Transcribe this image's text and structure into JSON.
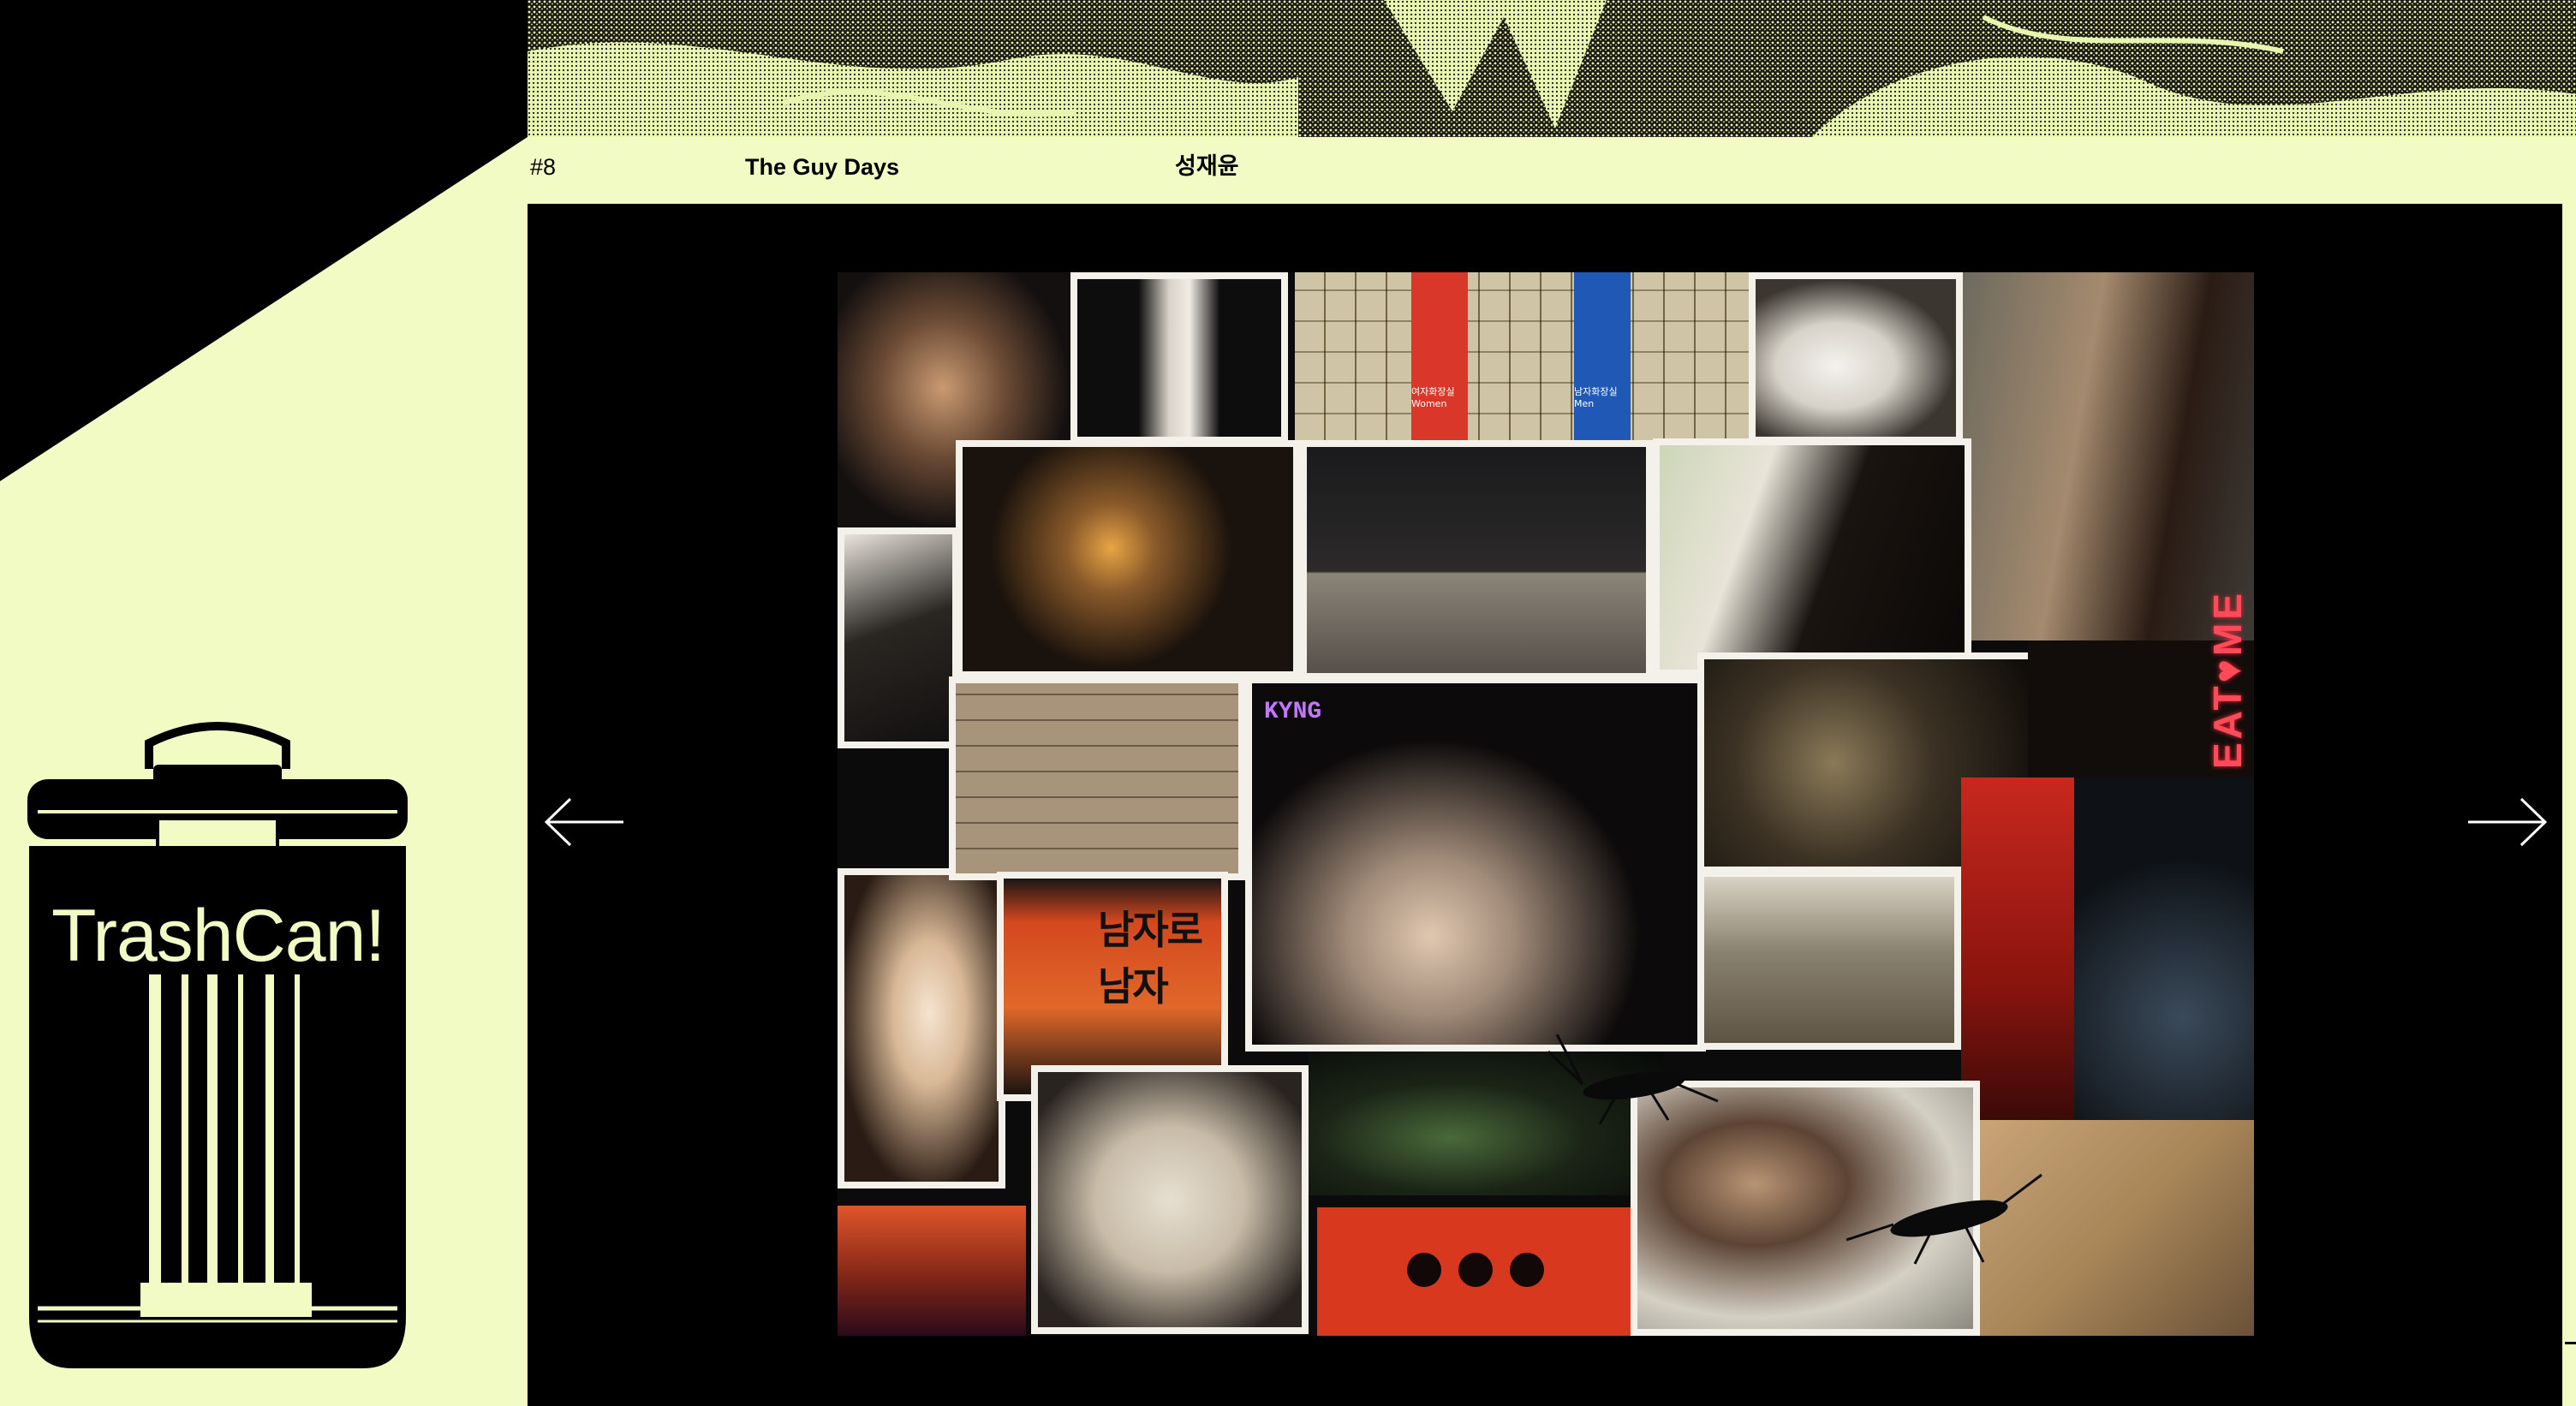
{
  "colors": {
    "background": "#f2fbc3",
    "dark": "#000000",
    "viewer": "#000000",
    "accent_red": "#d8372a",
    "accent_blue": "#1f58b5"
  },
  "article": {
    "number": "#8",
    "title": "The Guy Days",
    "author": "성재윤"
  },
  "logo": {
    "text": "TrashCan!"
  },
  "navigation": {
    "prev_icon": "arrow-left-icon",
    "next_icon": "arrow-right-icon"
  },
  "collage": {
    "sign_women": "여자화장실 Women",
    "sign_men": "남자화장실 Men",
    "neon_text": "EAT♥ME",
    "club_sign": "KYNG",
    "poster_text": "남자로 남자"
  }
}
